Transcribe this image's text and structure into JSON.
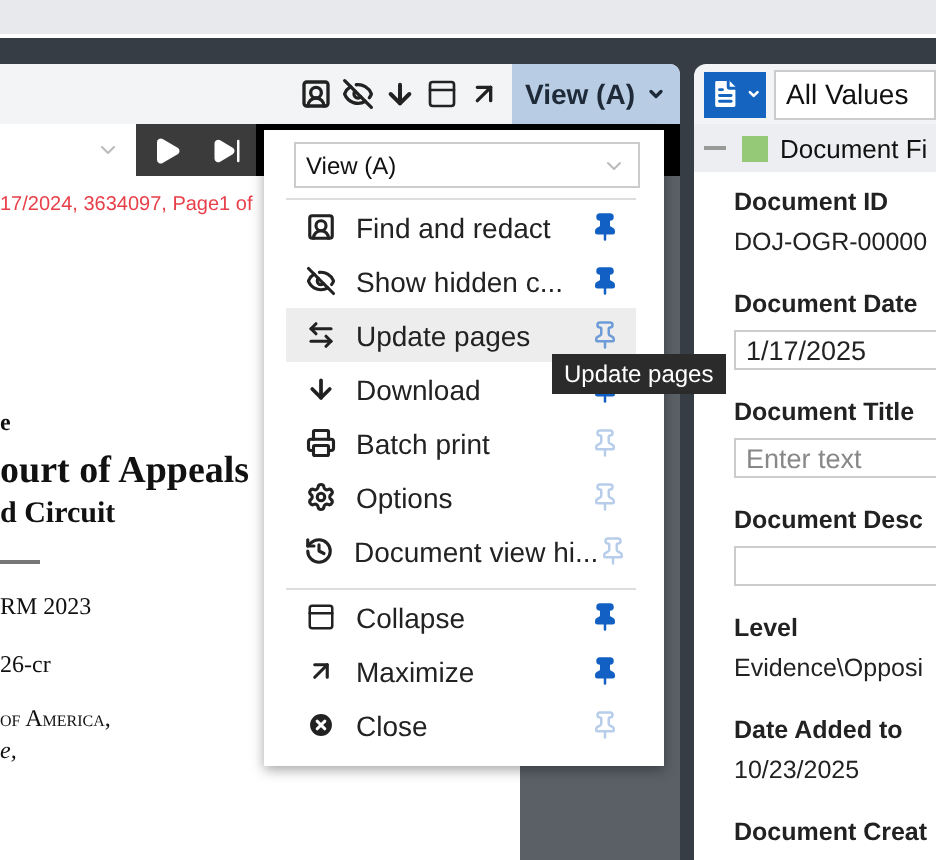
{
  "viewer": {
    "view_button": "View (A)",
    "doc_stamp": "17/2024, 3634097, Page1 of",
    "document_lines": [
      {
        "kind": "plain",
        "text": "e"
      },
      {
        "kind": "court",
        "text": "ourt of Appeals"
      },
      {
        "kind": "circuit",
        "text": "d Circuit"
      },
      {
        "kind": "rule"
      },
      {
        "kind": "term",
        "text": "RM 2023"
      },
      {
        "kind": "term",
        "text": "26-cr"
      },
      {
        "kind": "smallcaps",
        "text": "of America,"
      },
      {
        "kind": "italic",
        "text": "e,"
      }
    ]
  },
  "menu": {
    "select": "View (A)",
    "groups": [
      [
        {
          "label": "Find and redact",
          "pinned": true,
          "hovered": false
        },
        {
          "label": "Show hidden c...",
          "pinned": true,
          "hovered": false
        },
        {
          "label": "Update pages",
          "pinned": false,
          "hovered": true
        },
        {
          "label": "Download",
          "pinned": true,
          "hovered": false
        },
        {
          "label": "Batch print",
          "pinned": false,
          "hovered": false
        },
        {
          "label": "Options",
          "pinned": false,
          "hovered": false
        },
        {
          "label": "Document view hi...",
          "pinned": false,
          "hovered": false
        }
      ],
      [
        {
          "label": "Collapse",
          "pinned": true,
          "hovered": false
        },
        {
          "label": "Maximize",
          "pinned": true,
          "hovered": false
        },
        {
          "label": "Close",
          "pinned": false,
          "hovered": false
        }
      ]
    ]
  },
  "tooltip": "Update pages",
  "fields_panel": {
    "filter": "All Values",
    "section": {
      "label": "Document Fi",
      "expanded": true
    },
    "fields": [
      {
        "label": "Document ID",
        "kind": "text",
        "value": "DOJ-OGR-00000"
      },
      {
        "label": "Document Date",
        "kind": "input",
        "value": "1/17/2025"
      },
      {
        "label": "Document Title",
        "kind": "input",
        "placeholder": "Enter text"
      },
      {
        "label": "Document Desc",
        "kind": "input"
      },
      {
        "label": "Level",
        "kind": "text",
        "value": "Evidence\\Opposi"
      },
      {
        "label": "Date Added to",
        "kind": "text",
        "value": "10/23/2025"
      },
      {
        "label": "Document Creat",
        "kind": "label"
      }
    ]
  }
}
